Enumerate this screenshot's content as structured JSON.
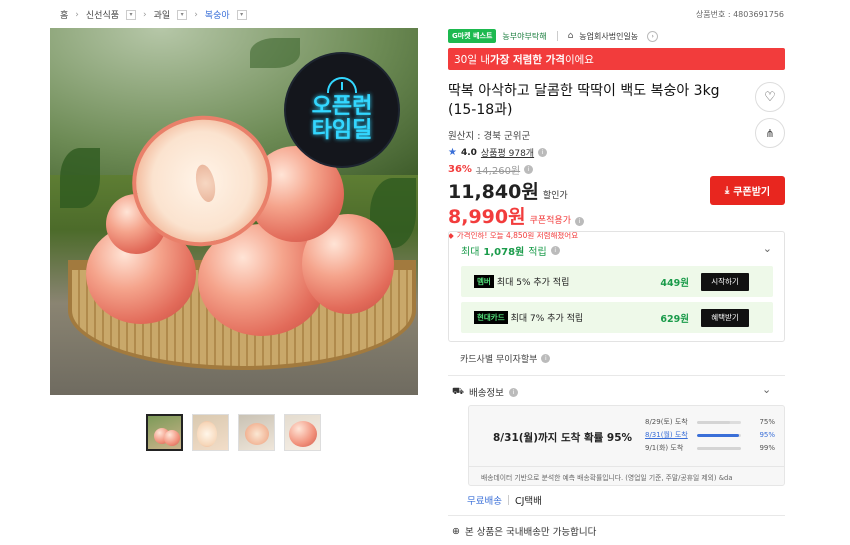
{
  "breadcrumb": {
    "home": "홈",
    "cat1": "신선식품",
    "cat2": "과일",
    "cat3": "복숭아"
  },
  "product_no": "상품번호 : 4803691756",
  "image": {
    "badge_line1": "오픈런",
    "badge_line2": "타임딜"
  },
  "thumbnails": [
    "thumb-1",
    "thumb-2",
    "thumb-3",
    "thumb-4"
  ],
  "tags": {
    "gmarket": "G마켓 베스트",
    "store_tag": "농부야부탁해",
    "store_name": "농업회사법인일농"
  },
  "banner": {
    "prefix": "30일 내 ",
    "bold": "가장 저렴한 가격",
    "suffix": "이에요"
  },
  "title": "딱복 아삭하고 달콤한 딱딱이 백도 복숭아 3kg (15-18과)",
  "origin": "원산지 : 경북 군위군",
  "rating": {
    "score": "4.0",
    "reviews": "상품평 978개"
  },
  "price": {
    "discount_pct": "36%",
    "original": "14,260원",
    "sale": "11,840원",
    "sale_label": "할인가",
    "coupon": "8,990원",
    "coupon_label": "쿠폰적용가",
    "saving_note": "가격인하! 오늘 4,850원 저렴해졌어요",
    "coupon_button": "쿠폰받기"
  },
  "reward": {
    "head_prefix": "최대 ",
    "head_amount": "1,078원",
    "head_suffix": " 적립",
    "rows": [
      {
        "label": "멤버",
        "text": "최대 5% 추가 적립",
        "amount": "449원",
        "button": "시작하기"
      },
      {
        "label": "현대카드",
        "text": "최대 7% 추가 적립",
        "amount": "629원",
        "button": "혜택받기"
      }
    ]
  },
  "card_installment": "카드사별 무이자할부",
  "shipping": {
    "header": "배송정보",
    "main": "8/31(월)까지 도착 확률 95%",
    "rows": [
      {
        "date": "8/29(토) 도착",
        "pct": "75%",
        "fill": 0.75
      },
      {
        "date": "8/31(월) 도착",
        "pct": "95%",
        "fill": 0.95
      },
      {
        "date": "9/1(화) 도착",
        "pct": "99%",
        "fill": 0.99
      }
    ],
    "note": "배송데이터 기반으로 분석한 예측 배송확률입니다. (영업일 기준, 주말/공휴일 제외) &da",
    "free": "무료배송",
    "courier": "CJ택배"
  },
  "domestic": "본 상품은 국내배송만 가능합니다",
  "colors": {
    "accent_red": "#f23c3c",
    "green": "#1a9b4a",
    "blue": "#3a6fd8"
  }
}
